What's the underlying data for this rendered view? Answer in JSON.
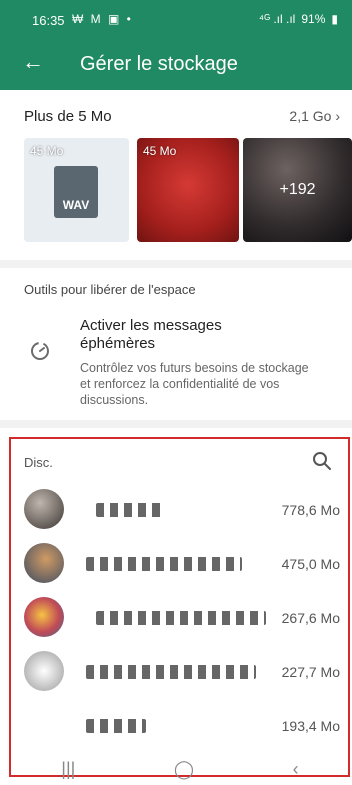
{
  "status": {
    "time": "16:35",
    "left_icons": "₩ M ▣ •",
    "battery": "91%",
    "signal": "⁴ᴳ .ıl .ıl"
  },
  "appbar": {
    "back_icon": "arrow-left",
    "title": "Gérer le stockage"
  },
  "large_files": {
    "label": "Plus de 5 Mo",
    "value": "2,1 Go",
    "chevron": "›",
    "thumbnails": [
      {
        "size": "45 Mo",
        "type": "WAV"
      },
      {
        "size": "45 Mo"
      },
      {
        "more": "+192"
      }
    ]
  },
  "tools": {
    "heading": "Outils pour libérer de l'espace",
    "item_title": "Activer les messages éphémères",
    "item_desc": "Contrôlez vos futurs besoins de stockage et renforcez la confidentialité de vos discussions."
  },
  "discussions": {
    "heading": "Disc.",
    "rows": [
      {
        "size": "778,6 Mo"
      },
      {
        "size": "475,0 Mo"
      },
      {
        "size": "267,6 Mo"
      },
      {
        "size": "227,7 Mo"
      },
      {
        "size": "193,4 Mo"
      }
    ]
  },
  "navbar": {
    "recent": "|||",
    "home": "◯",
    "back": "‹"
  }
}
